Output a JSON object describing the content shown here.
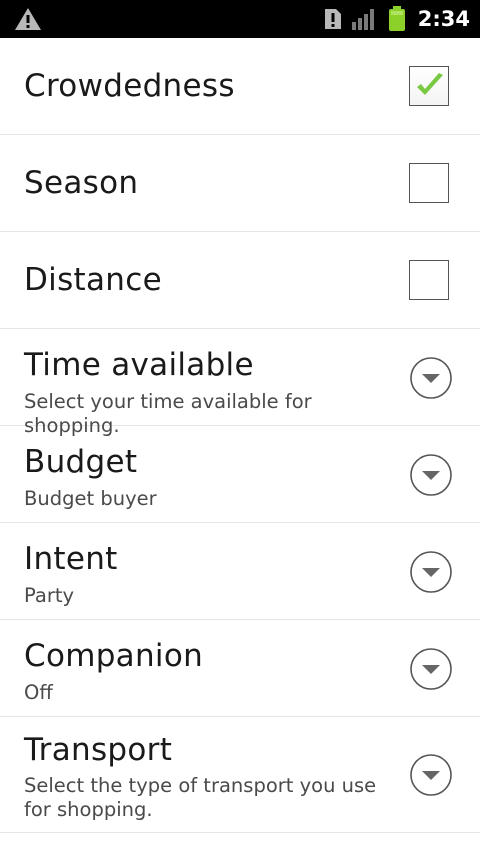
{
  "status_bar": {
    "time": "2:34",
    "icons": [
      "warning-icon",
      "sim-alert-icon",
      "signal-bars-icon",
      "battery-icon"
    ],
    "battery_color": "#8bd12a"
  },
  "settings": {
    "crowdedness": {
      "title": "Crowdedness",
      "checked": true
    },
    "season": {
      "title": "Season",
      "checked": false
    },
    "distance": {
      "title": "Distance",
      "checked": false
    },
    "time_available": {
      "title": "Time available",
      "summary": "Select your time available for shopping."
    },
    "budget": {
      "title": "Budget",
      "summary": "Budget buyer"
    },
    "intent": {
      "title": "Intent",
      "summary": "Party"
    },
    "companion": {
      "title": "Companion",
      "summary": "Off"
    },
    "transport": {
      "title": "Transport",
      "summary": "Select the type of transport you use for shopping."
    }
  },
  "colors": {
    "check_green": "#7ac943",
    "divider": "#e6e6e6",
    "title_text": "#1a1a1a",
    "summary_text": "#4a4a4a"
  }
}
